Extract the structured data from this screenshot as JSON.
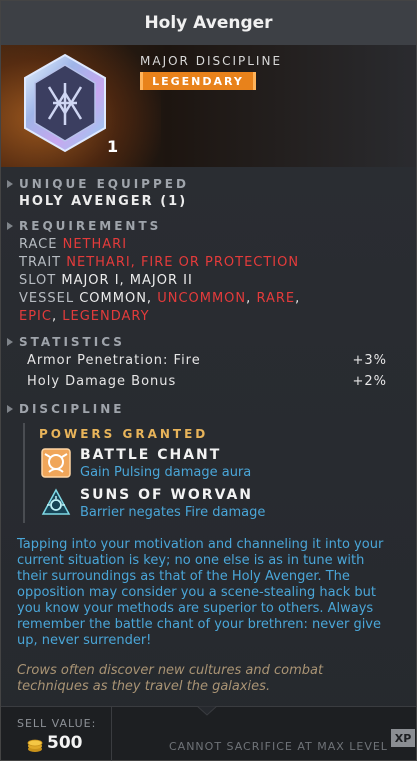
{
  "item": {
    "title": "Holy Avenger",
    "type_label": "MAJOR DISCIPLINE",
    "rarity": "LEGENDARY",
    "count": "1"
  },
  "unique": {
    "heading": "UNIQUE EQUIPPED",
    "value": "HOLY AVENGER (1)"
  },
  "requirements": {
    "heading": "REQUIREMENTS",
    "race_label": "RACE",
    "race_value": "NETHARI",
    "trait_label": "TRAIT",
    "trait_value": "NETHARI, FIRE OR PROTECTION",
    "slot_label": "SLOT",
    "slot_value": "MAJOR I, MAJOR II",
    "vessel_label": "VESSEL",
    "vessel_common": "COMMON,",
    "vessel_uncommon": "UNCOMMON",
    "vessel_rare": "RARE",
    "vessel_epic": "EPIC",
    "vessel_legendary": "LEGENDARY",
    "comma": ","
  },
  "statistics": {
    "heading": "STATISTICS",
    "rows": [
      {
        "label": "Armor Penetration: Fire",
        "value": "+3%"
      },
      {
        "label": "Holy Damage Bonus",
        "value": "+2%"
      }
    ]
  },
  "discipline": {
    "heading": "DISCIPLINE",
    "powers_heading": "POWERS GRANTED",
    "powers": [
      {
        "name": "BATTLE CHANT",
        "desc": "Gain Pulsing damage aura",
        "icon": "battle-chant-icon"
      },
      {
        "name": "SUNS OF WORVAN",
        "desc": "Barrier negates Fire damage",
        "icon": "suns-of-worvan-icon"
      }
    ],
    "description": "Tapping into your motivation and channeling it into your current situation is key; no one else is as in tune with their surroundings as that of the Holy Avenger. The opposition may consider you a scene-stealing hack but you know your methods are superior to others. Always remember the battle chant of your brethren: never give up, never surrender!",
    "flavor": "Crows often discover new cultures and combat techniques as they travel the galaxies."
  },
  "footer": {
    "sell_label": "SELL VALUE:",
    "sell_value": "500",
    "sacrifice_text": "CANNOT SACRIFICE AT MAX LEVEL",
    "xp_label": "XP"
  },
  "colors": {
    "legendary": "#e8821b",
    "requirement_red": "#e43b3b",
    "description_blue": "#4aa6d8",
    "powers_gold": "#e8b45a"
  }
}
